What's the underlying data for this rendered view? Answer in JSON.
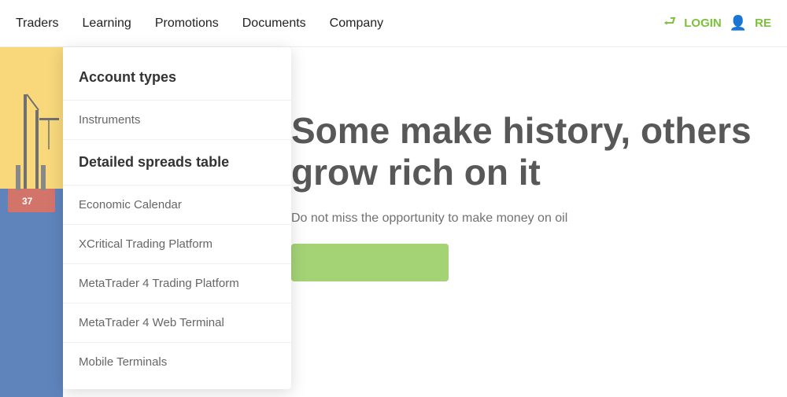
{
  "header": {
    "nav_items": [
      {
        "label": "Traders",
        "id": "traders"
      },
      {
        "label": "Learning",
        "id": "learning"
      },
      {
        "label": "Promotions",
        "id": "promotions"
      },
      {
        "label": "Documents",
        "id": "documents"
      },
      {
        "label": "Company",
        "id": "company"
      }
    ],
    "login_label": "LOGIN",
    "register_label": "RE"
  },
  "dropdown": {
    "items": [
      {
        "label": "Account types",
        "id": "account-types",
        "highlighted": true
      },
      {
        "label": "Instruments",
        "id": "instruments"
      },
      {
        "label": "Detailed spreads table",
        "id": "detailed-spreads",
        "highlighted": true
      },
      {
        "label": "Economic Calendar",
        "id": "economic-calendar"
      },
      {
        "label": "XCritical Trading Platform",
        "id": "xcritical"
      },
      {
        "label": "MetaTrader 4 Trading Platform",
        "id": "metatrader4"
      },
      {
        "label": "MetaTrader 4 Web Terminal",
        "id": "metatrader4-web"
      },
      {
        "label": "Mobile Terminals",
        "id": "mobile-terminals"
      }
    ]
  },
  "hero": {
    "title": "Some make history, others grow rich on it",
    "subtitle": "Do not miss the opportunity to make money on oil",
    "cta_label": ""
  }
}
